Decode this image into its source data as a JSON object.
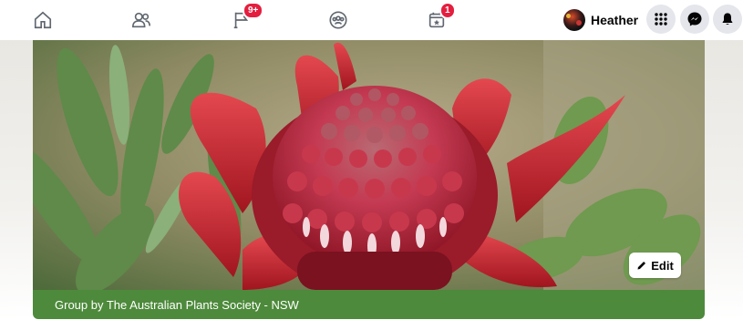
{
  "nav": {
    "items": [
      {
        "name": "home-icon"
      },
      {
        "name": "friends-icon"
      },
      {
        "name": "pages-flag-icon",
        "badge": "9+"
      },
      {
        "name": "groups-icon"
      },
      {
        "name": "events-icon",
        "badge": "1"
      }
    ],
    "badge_color": "#e41e3f"
  },
  "profile": {
    "name": "Heather"
  },
  "actions": [
    {
      "name": "menu-grid-icon"
    },
    {
      "name": "messenger-icon"
    },
    {
      "name": "notifications-bell-icon"
    }
  ],
  "cover": {
    "edit_label": "Edit",
    "group_caption": "Group by The Australian Plants Society - NSW",
    "strip_color": "#4d8a3b"
  }
}
